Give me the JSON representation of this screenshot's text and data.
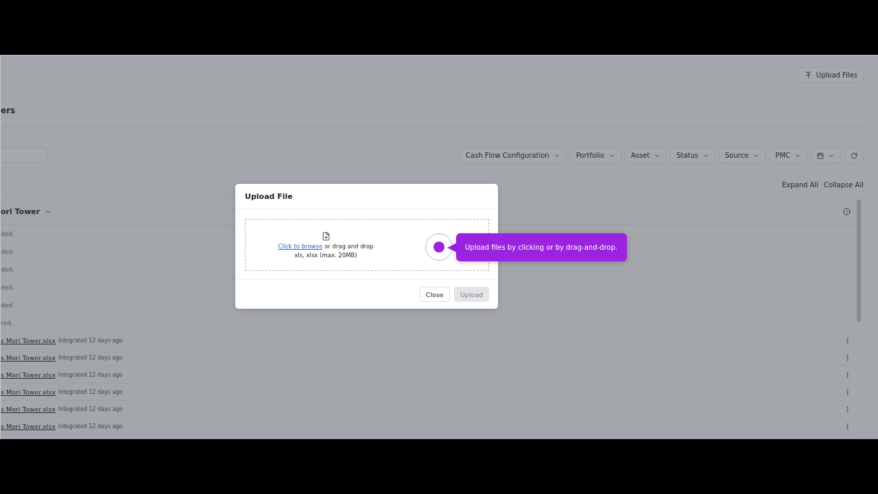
{
  "top_bar": {
    "upload_button": "Upload Files"
  },
  "title": "ers",
  "filters": [
    "Cash Flow Configuration",
    "Portfolio",
    "Asset",
    "Status",
    "Source",
    "PMC"
  ],
  "actions": [
    "Expand All",
    "Collapse All"
  ],
  "group": {
    "title": "ori Tower",
    "expanded": true,
    "notes": [
      "ded.",
      "ded.",
      "ded.",
      "ded.",
      "ded.",
      "red."
    ],
    "files": [
      {
        "name": "s Mori Tower.xlsx",
        "status": "Integrated 12 days ago"
      },
      {
        "name": "s Mori Tower.xlsx",
        "status": "Integrated 12 days ago"
      },
      {
        "name": "s Mori Tower.xlsx",
        "status": "Integrated 12 days ago"
      },
      {
        "name": "s Mori Tower.xlsx",
        "status": "Integrated 12 days ago"
      },
      {
        "name": "s Mori Tower.xlsx",
        "status": "Integrated 12 days ago"
      },
      {
        "name": "s Mori Tower.xlsx",
        "status": "Integrated 12 days ago"
      }
    ]
  },
  "modal": {
    "title": "Upload File",
    "link": "Click to browse",
    "link_rest": "or drag and drop",
    "formats": "xls, xlsx (max. 20MB)",
    "buttons": [
      {
        "label": "Close",
        "disabled": false
      },
      {
        "label": "Upload",
        "disabled": true
      }
    ]
  },
  "tooltip": {
    "text": "Upload files by clicking or by drag-and-drop."
  }
}
